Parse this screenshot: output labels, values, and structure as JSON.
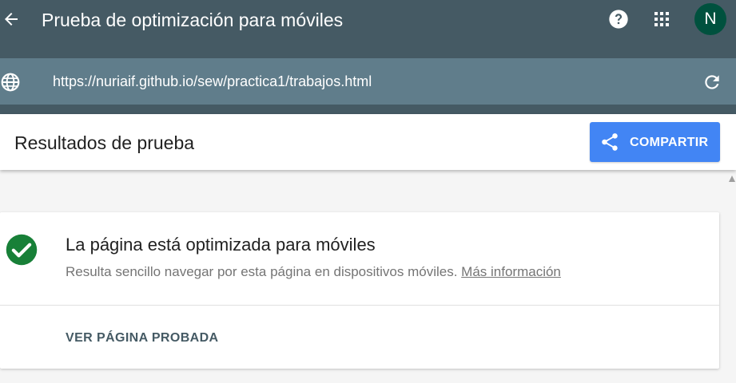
{
  "app_bar": {
    "title": "Prueba de optimización para móviles",
    "avatar_initial": "N"
  },
  "url_bar": {
    "url": "https://nuriaif.github.io/sew/practica1/trabajos.html"
  },
  "results_header": {
    "title": "Resultados de prueba",
    "share_label": "COMPARTIR"
  },
  "result_card": {
    "title": "La página está optimizada para móviles",
    "description": "Resulta sencillo navegar por esta página en dispositivos móviles.",
    "more_link": "Más información",
    "view_button": "VER PÁGINA PROBADA"
  },
  "icons": {
    "back": "arrow-back-icon",
    "help": "help-icon",
    "apps": "apps-grid-icon",
    "globe": "globe-icon",
    "reload": "reload-icon",
    "share": "share-icon",
    "check": "check-circle-icon"
  },
  "colors": {
    "app_bar": "#455a64",
    "url_field": "#607d8b",
    "share_button": "#4285f4",
    "success": "#188038",
    "avatar": "#00513e"
  }
}
